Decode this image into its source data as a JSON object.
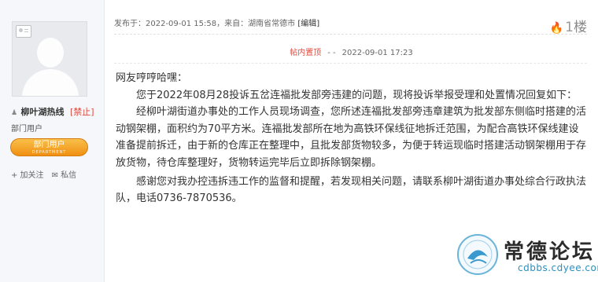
{
  "post": {
    "meta_prefix": "发布于：",
    "date": "2022-09-01 15:58",
    "from_prefix": "，来自：",
    "location": "湖南省常德市",
    "edit_label": "[编辑]",
    "floor_number": "1",
    "floor_suffix": "楼"
  },
  "pin_bar": {
    "tag": "帖内置顶",
    "dash": "- -",
    "date": "2022-09-01 17:23"
  },
  "author": {
    "name": "柳叶湖热线",
    "status": "[禁止]",
    "role": "部门用户",
    "badge_cn": "部门用户",
    "badge_en": "DEPARTMENT",
    "follow": "+ 加关注",
    "message": "私信"
  },
  "content": {
    "greeting": "网友哼哼哈嘿：",
    "p1": "您于2022年08月28投诉五岔连福批发部旁违建的问题，现将投诉举报受理和处置情况回复如下：",
    "p2": "经柳叶湖街道办事处的工作人员现场调查，您所述连福批发部旁违章建筑为批发部东侧临时搭建的活动钢架棚，面积约为70平方米。连福批发部所在地为高铁环保线征地拆迁范围，为配合高铁环保线建设准备提前拆迁，由于新的仓库正在整理中，且批发部货物较多，为便于转运现临时搭建活动钢架棚用于存放货物，待仓库整理好，货物转运完毕后立即拆除钢架棚。",
    "p3": "感谢您对我办控违拆违工作的监督和提醒，若发现相关问题，请联系柳叶湖街道办事处综合行政执法队，电话0736-7870536。"
  },
  "watermark": {
    "title": "常德论坛",
    "url": "cdbbs.cdyee.com"
  },
  "colors": {
    "accent_red": "#e2493c",
    "badge_orange": "#f08f12",
    "fire": "#ff6a32"
  }
}
